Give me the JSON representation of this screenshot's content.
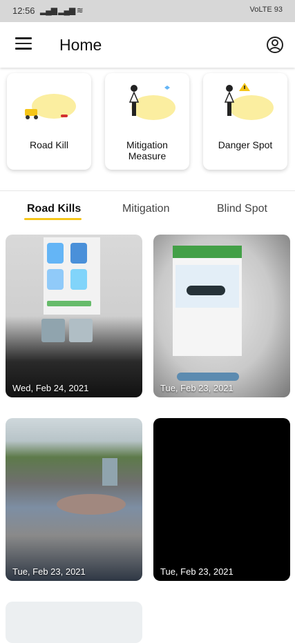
{
  "status_bar": {
    "time": "12:56",
    "right": "VoLTE 93"
  },
  "app_bar": {
    "title": "Home"
  },
  "categories": [
    {
      "label": "Road Kill",
      "icon": "road-kill-illustration"
    },
    {
      "label": "Mitigation Measure",
      "icon": "mitigation-illustration"
    },
    {
      "label": "Danger Spot",
      "icon": "danger-spot-illustration"
    }
  ],
  "tabs": [
    {
      "label": "Road Kills",
      "active": true
    },
    {
      "label": "Mitigation",
      "active": false
    },
    {
      "label": "Blind Spot",
      "active": false
    }
  ],
  "photos": [
    {
      "date": "Wed, Feb 24, 2021"
    },
    {
      "date": "Tue, Feb 23, 2021"
    },
    {
      "date": "Tue, Feb 23, 2021"
    },
    {
      "date": "Tue, Feb 23, 2021"
    }
  ],
  "colors": {
    "accent": "#f5c518",
    "illustration_blob": "#fbeea0"
  }
}
